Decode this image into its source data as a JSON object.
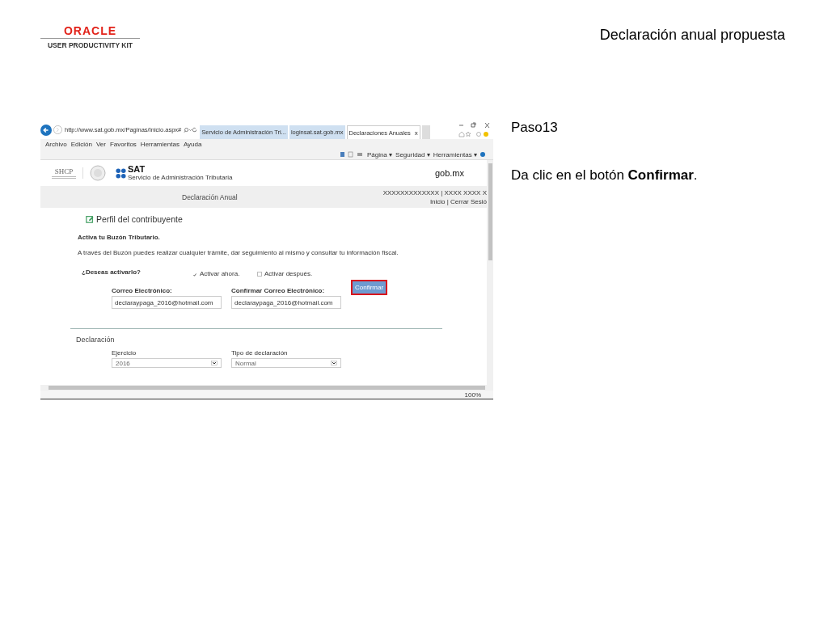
{
  "header": {
    "brand": "ORACLE",
    "product": "USER PRODUCTIVITY KIT",
    "title": "Declaración anual propuesta"
  },
  "browser": {
    "address": "http://www.sat.gob.mx/Paginas/Inicio.aspx#",
    "tabs": [
      {
        "label": "Servicio de Administración Tri...",
        "selected": false
      },
      {
        "label": "loginsat.sat.gob.mx",
        "selected": false
      },
      {
        "label": "Declaraciones Anuales",
        "selected": true,
        "close": "x"
      }
    ],
    "menu": [
      "Archivo",
      "Edición",
      "Ver",
      "Favoritos",
      "Herramientas",
      "Ayuda"
    ],
    "toolbar": [
      "Página ▾",
      "Seguridad ▾",
      "Herramientas ▾"
    ],
    "zoom": "100%"
  },
  "site": {
    "shcp": "SHCP",
    "sat": "SAT",
    "sat_subtitle": "Servicio de Administración Tributaria",
    "gob": "gob.mx",
    "band_title": "Declaración Anual",
    "user": "XXXXXXXXXXXXX | XXXX XXXX X",
    "links": "Inicio | Cerrar Sesió"
  },
  "profile": {
    "heading": "Perfil del contribuyente",
    "subheading": "Activa tu Buzón Tributario.",
    "text": "A través del Buzón puedes realizar cualquier trámite, dar seguimiento al mismo y consultar tu información fiscal.",
    "question": "¿Deseas activarlo?",
    "options": [
      {
        "label": "Activar ahora.",
        "checked": true
      },
      {
        "label": "Activar después.",
        "checked": false
      }
    ],
    "fields": [
      {
        "label": "Correo Electrónico:",
        "value": "declaraypaga_2016@hotmail.com"
      },
      {
        "label": "Confirmar Correo Electrónico:",
        "value": "declaraypaga_2016@hotmail.com"
      }
    ],
    "button": {
      "label": "Confirmar",
      "highlighted": true
    }
  },
  "declaration": {
    "heading": "Declaración",
    "fields": [
      {
        "label": "Ejercicio",
        "value": "2016"
      },
      {
        "label": "Tipo de declaración",
        "value": "Normal"
      }
    ]
  },
  "instructions": {
    "step": "Paso13",
    "text": "Da clic en el botón **Confirmar**."
  }
}
